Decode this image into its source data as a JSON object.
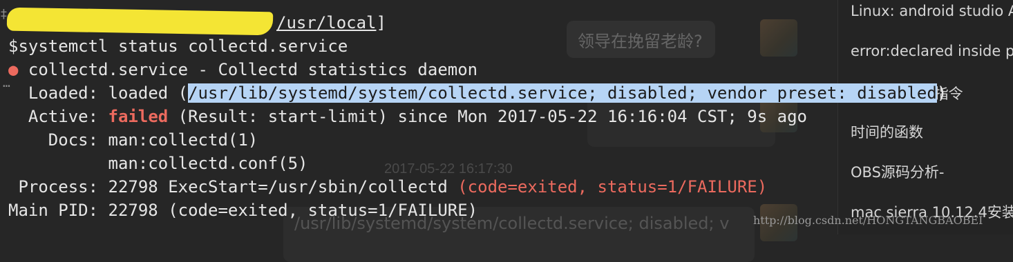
{
  "terminal": {
    "prompt_path": "/usr/local",
    "prompt_close": "]",
    "command": "$systemctl status collectd.service",
    "service_line": "collectd.service - Collectd statistics daemon",
    "loaded_label": "Loaded:",
    "loaded_value": "loaded (",
    "loaded_highlight": "/usr/lib/systemd/system/collectd.service; disabled; vendor preset: disabled",
    "loaded_close": ")",
    "active_label": "Active:",
    "active_status": "failed",
    "active_rest": "(Result: start-limit) since Mon 2017-05-22 16:16:04 CST; 9s ago",
    "docs_label": "Docs:",
    "docs_1": "man:collectd(1)",
    "docs_2": "man:collectd.conf(5)",
    "process_label": "Process:",
    "process_value": "22798 ExecStart=/usr/sbin/collectd",
    "process_code": "(code=exited, status=1/FAILURE)",
    "mainpid_label": "Main PID:",
    "mainpid_value": "22798 (code=exited, status=1/FAILURE)"
  },
  "chat": {
    "bubble_1": "领导在挽留老龄?",
    "timestamp": "2017-05-22 16:17:30",
    "bubble_3": "/usr/lib/systemd/system/collectd.service; disabled; v"
  },
  "sidebar": {
    "items": [
      "Linux: android studio A",
      "error:declared inside p",
      "each指令",
      "时间的函数",
      "OBS源码分析-",
      "mac sierra 10.12.4安装"
    ]
  },
  "watermark": "http://blog.csdn.net/HONGTANGBAOBEI",
  "colors": {
    "background": "#262626",
    "text": "#e6e6e6",
    "error_red": "#ec6a5e",
    "selection": "#b6d4f5",
    "redaction_yellow": "#f4e534"
  }
}
